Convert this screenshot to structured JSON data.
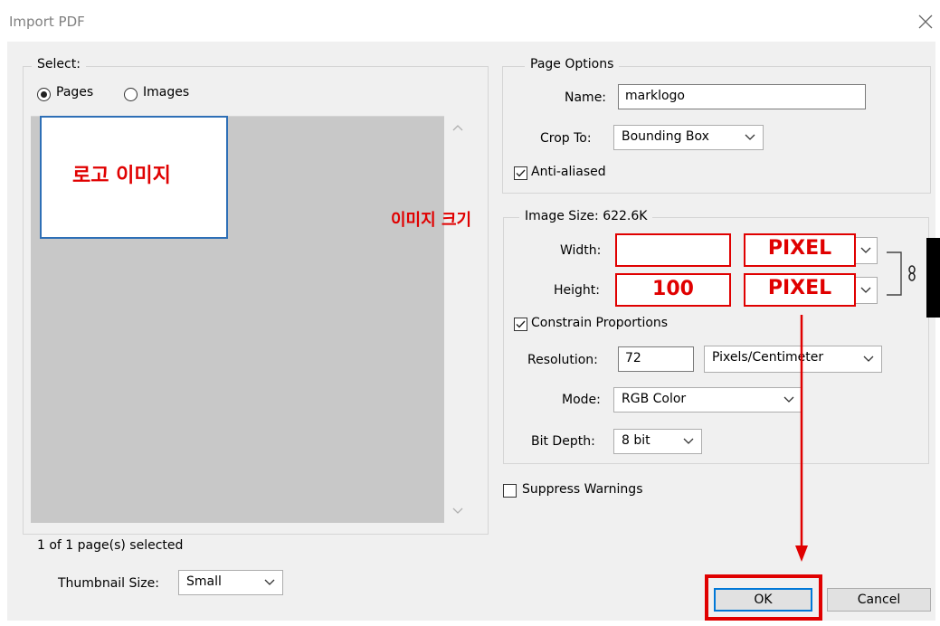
{
  "window": {
    "title": "Import PDF"
  },
  "select_group": {
    "legend": "Select:",
    "radio_pages": "Pages",
    "radio_images": "Images",
    "selected_mode": "Pages",
    "thumbnail_text": "로고 이미지",
    "selection_status": "1 of 1 page(s) selected",
    "thumbnail_size_label": "Thumbnail Size:",
    "thumbnail_size_value": "Small"
  },
  "page_options": {
    "legend": "Page Options",
    "name_label": "Name:",
    "name_value": "marklogo",
    "crop_label": "Crop To:",
    "crop_value": "Bounding Box",
    "anti_aliased_label": "Anti-aliased",
    "anti_aliased_checked": true
  },
  "image_size": {
    "annotation": "이미지 크기",
    "legend": "Image Size: 622.6K",
    "width_label": "Width:",
    "width_value": "",
    "width_unit": "PIXEL",
    "height_label": "Height:",
    "height_value": "100",
    "height_unit": "PIXEL",
    "constrain_label": "Constrain Proportions",
    "constrain_checked": true,
    "resolution_label": "Resolution:",
    "resolution_value": "72",
    "resolution_unit": "Pixels/Centimeter",
    "mode_label": "Mode:",
    "mode_value": "RGB Color",
    "bitdepth_label": "Bit Depth:",
    "bitdepth_value": "8 bit"
  },
  "suppress_warnings": {
    "label": "Suppress Warnings",
    "checked": false
  },
  "buttons": {
    "ok": "OK",
    "cancel": "Cancel"
  },
  "colors": {
    "annotation_red": "#e00000",
    "dialog_bg": "#f0f0f0",
    "preview_bg": "#c8c8c8",
    "focus_blue": "#0078d7"
  }
}
